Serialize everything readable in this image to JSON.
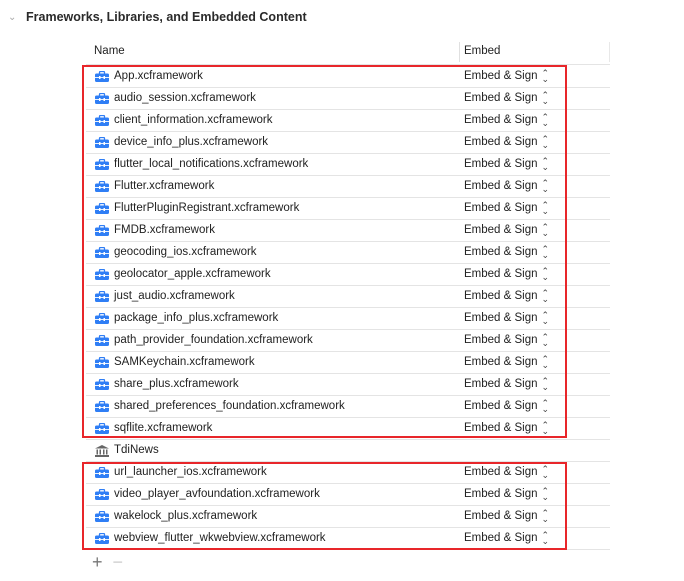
{
  "section": {
    "title": "Frameworks, Libraries, and Embedded Content",
    "chevron_icon": "chevron-down-icon"
  },
  "columns": {
    "name": "Name",
    "embed": "Embed"
  },
  "accent": "#2f7ef5",
  "highlight": "#e8262a",
  "rows": [
    {
      "name": "App.xcframework",
      "embed": "Embed & Sign",
      "icon": "toolbox-icon"
    },
    {
      "name": "audio_session.xcframework",
      "embed": "Embed & Sign",
      "icon": "toolbox-icon"
    },
    {
      "name": "client_information.xcframework",
      "embed": "Embed & Sign",
      "icon": "toolbox-icon"
    },
    {
      "name": "device_info_plus.xcframework",
      "embed": "Embed & Sign",
      "icon": "toolbox-icon"
    },
    {
      "name": "flutter_local_notifications.xcframework",
      "embed": "Embed & Sign",
      "icon": "toolbox-icon"
    },
    {
      "name": "Flutter.xcframework",
      "embed": "Embed & Sign",
      "icon": "toolbox-icon"
    },
    {
      "name": "FlutterPluginRegistrant.xcframework",
      "embed": "Embed & Sign",
      "icon": "toolbox-icon"
    },
    {
      "name": "FMDB.xcframework",
      "embed": "Embed & Sign",
      "icon": "toolbox-icon"
    },
    {
      "name": "geocoding_ios.xcframework",
      "embed": "Embed & Sign",
      "icon": "toolbox-icon"
    },
    {
      "name": "geolocator_apple.xcframework",
      "embed": "Embed & Sign",
      "icon": "toolbox-icon"
    },
    {
      "name": "just_audio.xcframework",
      "embed": "Embed & Sign",
      "icon": "toolbox-icon"
    },
    {
      "name": "package_info_plus.xcframework",
      "embed": "Embed & Sign",
      "icon": "toolbox-icon"
    },
    {
      "name": "path_provider_foundation.xcframework",
      "embed": "Embed & Sign",
      "icon": "toolbox-icon"
    },
    {
      "name": "SAMKeychain.xcframework",
      "embed": "Embed & Sign",
      "icon": "toolbox-icon"
    },
    {
      "name": "share_plus.xcframework",
      "embed": "Embed & Sign",
      "icon": "toolbox-icon"
    },
    {
      "name": "shared_preferences_foundation.xcframework",
      "embed": "Embed & Sign",
      "icon": "toolbox-icon"
    },
    {
      "name": "sqflite.xcframework",
      "embed": "Embed & Sign",
      "icon": "toolbox-icon"
    },
    {
      "name": "TdiNews",
      "embed": "",
      "icon": "library-icon"
    },
    {
      "name": "url_launcher_ios.xcframework",
      "embed": "Embed & Sign",
      "icon": "toolbox-icon"
    },
    {
      "name": "video_player_avfoundation.xcframework",
      "embed": "Embed & Sign",
      "icon": "toolbox-icon"
    },
    {
      "name": "wakelock_plus.xcframework",
      "embed": "Embed & Sign",
      "icon": "toolbox-icon"
    },
    {
      "name": "webview_flutter_wkwebview.xcframework",
      "embed": "Embed & Sign",
      "icon": "toolbox-icon"
    }
  ],
  "footer": {
    "add": "+",
    "remove": "−"
  }
}
